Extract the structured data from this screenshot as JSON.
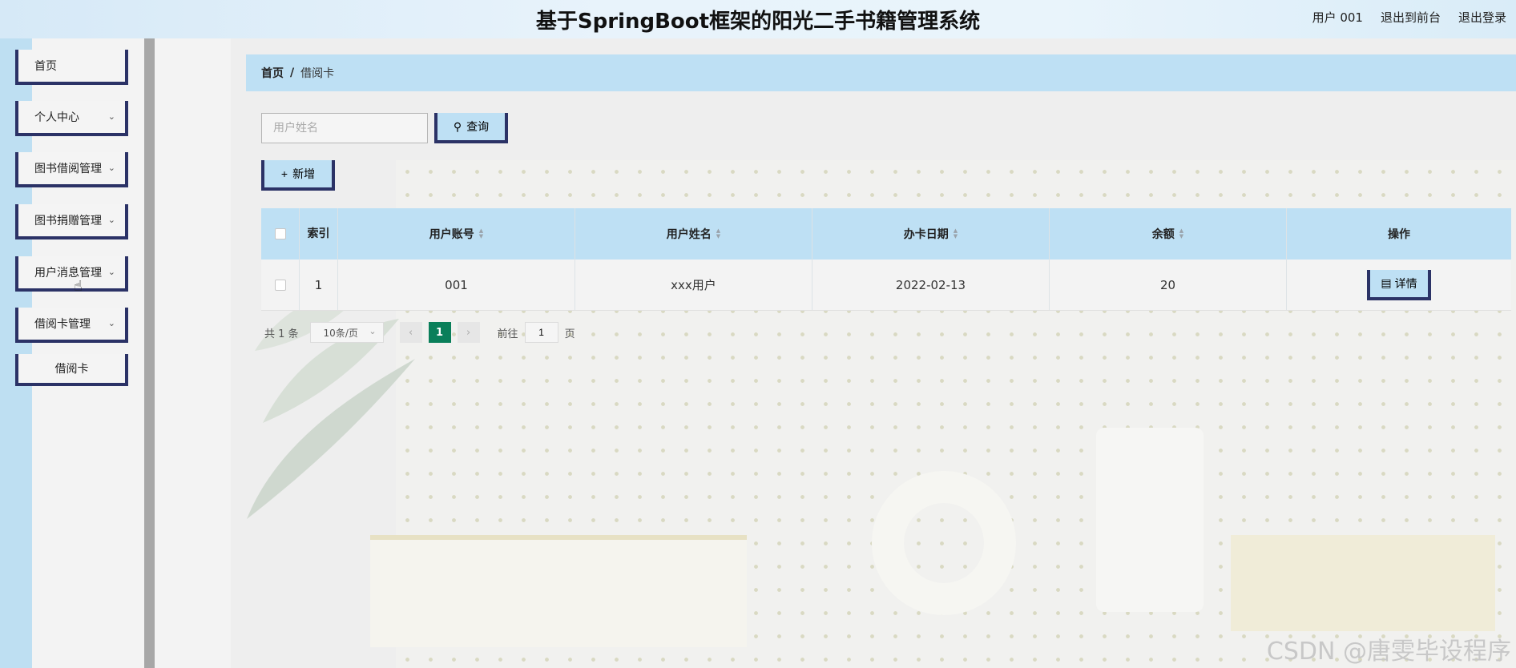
{
  "header": {
    "title": "基于SpringBoot框架的阳光二手书籍管理系统",
    "user": "用户 001",
    "exit_front": "退出到前台",
    "logout": "退出登录"
  },
  "sidebar": {
    "items": [
      {
        "label": "首页"
      },
      {
        "label": "个人中心"
      },
      {
        "label": "图书借阅管理"
      },
      {
        "label": "图书捐赠管理"
      },
      {
        "label": "用户消息管理"
      },
      {
        "label": "借阅卡管理"
      }
    ],
    "sub_item": "借阅卡"
  },
  "breadcrumb": {
    "home": "首页",
    "separator": "/",
    "current": "借阅卡"
  },
  "search": {
    "placeholder": "用户姓名",
    "query_label": "查询"
  },
  "toolbar": {
    "add_label": "新增"
  },
  "table": {
    "headers": {
      "index": "索引",
      "account": "用户账号",
      "name": "用户姓名",
      "date": "办卡日期",
      "balance": "余额",
      "operation": "操作"
    },
    "rows": [
      {
        "index": "1",
        "account": "001",
        "name": "xxx用户",
        "date": "2022-02-13",
        "balance": "20",
        "action": "详情"
      }
    ]
  },
  "pagination": {
    "total": "共 1 条",
    "page_size": "10条/页",
    "current_page": "1",
    "goto_label": "前往",
    "goto_value": "1",
    "page_suffix": "页"
  },
  "watermark": "CSDN @唐雯毕设程序",
  "colors": {
    "accent_blue": "#bee0f4",
    "border_navy": "#2b3266",
    "page_active": "#0a7f5a"
  }
}
